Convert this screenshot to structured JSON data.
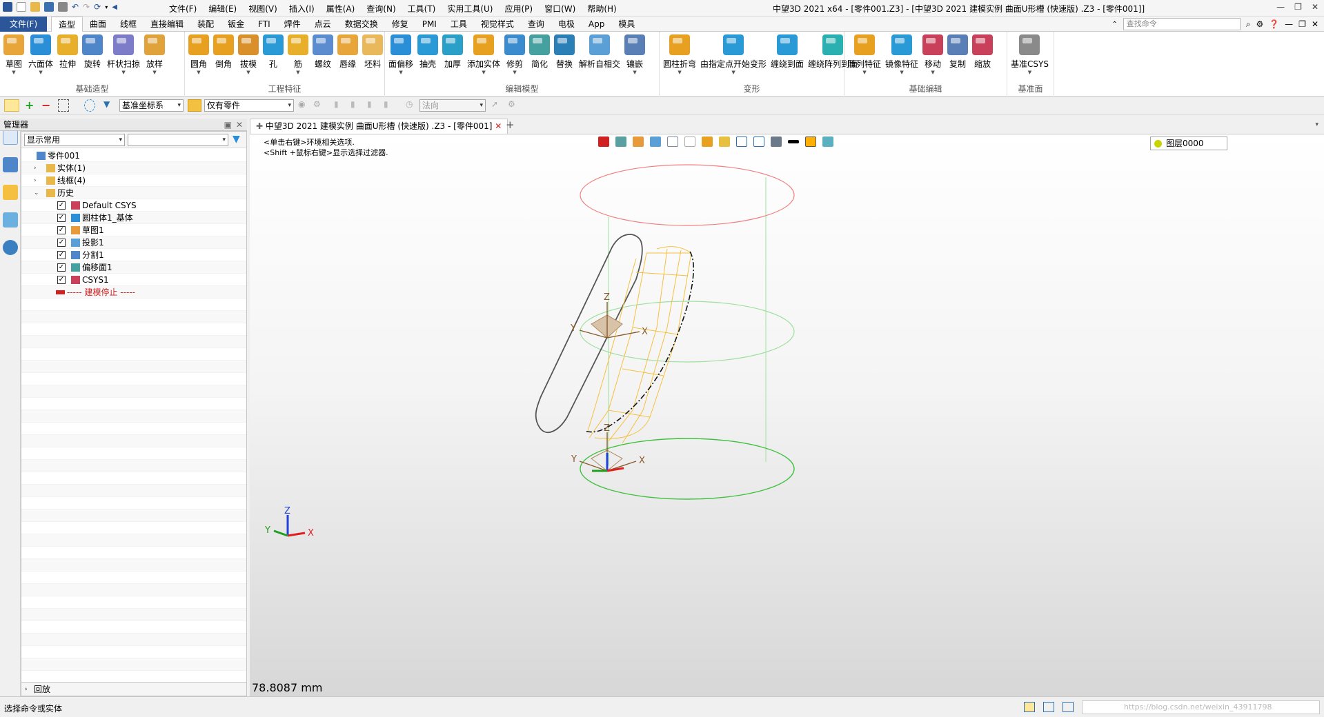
{
  "title_bar": {
    "window_title": "中望3D 2021 x64 - [零件001.Z3] - [中望3D 2021 建模实例 曲面U形槽 (快速版) .Z3 - [零件001]]",
    "menus": [
      "文件(F)",
      "编辑(E)",
      "视图(V)",
      "插入(I)",
      "属性(A)",
      "查询(N)",
      "工具(T)",
      "实用工具(U)",
      "应用(P)",
      "窗口(W)",
      "帮助(H)"
    ]
  },
  "ribbon_tabs": {
    "file_tab": "文件(F)",
    "tabs": [
      "造型",
      "曲面",
      "线框",
      "直接编辑",
      "装配",
      "钣金",
      "FTI",
      "焊件",
      "点云",
      "数据交换",
      "修复",
      "PMI",
      "工具",
      "视觉样式",
      "查询",
      "电极",
      "App",
      "模具"
    ],
    "active_index": 0,
    "command_search_placeholder": "查找命令"
  },
  "ribbon_groups": [
    {
      "label": "基础造型",
      "buttons": [
        {
          "label": "草图",
          "icon": "sketch-icon",
          "color": "#e8a63a",
          "dropdown": true
        },
        {
          "label": "六面体",
          "icon": "box-icon",
          "color": "#2a8fd6",
          "dropdown": true
        },
        {
          "label": "拉伸",
          "icon": "extrude-icon",
          "color": "#e8b02a",
          "dropdown": false
        },
        {
          "label": "旋转",
          "icon": "revolve-icon",
          "color": "#4f86c9",
          "dropdown": false
        },
        {
          "label": "杆状扫掠",
          "icon": "sweep-icon",
          "color": "#7c7cc9",
          "dropdown": true
        },
        {
          "label": "放样",
          "icon": "loft-icon",
          "color": "#e0a23a",
          "dropdown": true
        }
      ]
    },
    {
      "label": "工程特征",
      "buttons": [
        {
          "label": "圆角",
          "icon": "fillet-icon",
          "color": "#e8a020",
          "dropdown": true
        },
        {
          "label": "倒角",
          "icon": "chamfer-icon",
          "color": "#e8a020",
          "dropdown": false
        },
        {
          "label": "拔模",
          "icon": "draft-icon",
          "color": "#d9902a",
          "dropdown": true
        },
        {
          "label": "孔",
          "icon": "hole-icon",
          "color": "#2a9ad6",
          "dropdown": false
        },
        {
          "label": "筋",
          "icon": "rib-icon",
          "color": "#e8b02a",
          "dropdown": true
        },
        {
          "label": "螺纹",
          "icon": "thread-icon",
          "color": "#5a8ccf",
          "dropdown": false
        },
        {
          "label": "唇缘",
          "icon": "lip-icon",
          "color": "#e8a63a",
          "dropdown": false
        },
        {
          "label": "坯料",
          "icon": "stock-icon",
          "color": "#e8b85a",
          "dropdown": false
        }
      ]
    },
    {
      "label": "编辑模型",
      "buttons": [
        {
          "label": "面偏移",
          "icon": "face-offset-icon",
          "color": "#2a8fd6",
          "dropdown": true
        },
        {
          "label": "抽壳",
          "icon": "shell-icon",
          "color": "#2a9ad6",
          "dropdown": false
        },
        {
          "label": "加厚",
          "icon": "thicken-icon",
          "color": "#2aa0c9",
          "dropdown": false
        },
        {
          "label": "添加实体",
          "icon": "add-solid-icon",
          "color": "#e8a020",
          "dropdown": true
        },
        {
          "label": "修剪",
          "icon": "trim-icon",
          "color": "#3b8ccf",
          "dropdown": true
        },
        {
          "label": "简化",
          "icon": "simplify-icon",
          "color": "#45a0a0",
          "dropdown": false
        },
        {
          "label": "替换",
          "icon": "replace-icon",
          "color": "#2a7fb6",
          "dropdown": false
        },
        {
          "label": "解析自相交",
          "icon": "self-intersect-icon",
          "color": "#5a9fd6",
          "dropdown": false
        },
        {
          "label": "镶嵌",
          "icon": "emboss-icon",
          "color": "#5a7fb6",
          "dropdown": true
        }
      ]
    },
    {
      "label": "变形",
      "buttons": [
        {
          "label": "圆柱折弯",
          "icon": "cylinder-bend-icon",
          "color": "#e8a020",
          "dropdown": true
        },
        {
          "label": "由指定点开始变形",
          "icon": "point-deform-icon",
          "color": "#2a9ad6",
          "dropdown": true
        },
        {
          "label": "缠绕到面",
          "icon": "wrap-face-icon",
          "color": "#2a9ad6",
          "dropdown": false
        },
        {
          "label": "缠绕阵列到面",
          "icon": "wrap-pattern-icon",
          "color": "#2ab0b0",
          "dropdown": false
        }
      ]
    },
    {
      "label": "基础编辑",
      "buttons": [
        {
          "label": "阵列特征",
          "icon": "pattern-icon",
          "color": "#e8a020",
          "dropdown": true
        },
        {
          "label": "镜像特征",
          "icon": "mirror-icon",
          "color": "#2a9ad6",
          "dropdown": true
        },
        {
          "label": "移动",
          "icon": "move-icon",
          "color": "#c9405a",
          "dropdown": true
        },
        {
          "label": "复制",
          "icon": "copy-icon",
          "color": "#5a7fb6",
          "dropdown": false
        },
        {
          "label": "缩放",
          "icon": "scale-icon",
          "color": "#c9405a",
          "dropdown": false
        }
      ]
    },
    {
      "label": "基准面",
      "buttons": [
        {
          "label": "基准CSYS",
          "icon": "datum-csys-icon",
          "color": "#8a8a8a",
          "dropdown": true
        }
      ]
    }
  ],
  "toolbar2": {
    "coord_system": "基准坐标系",
    "filter": "仅有零件",
    "direction_placeholder": "法向"
  },
  "manager": {
    "title": "管理器",
    "filter_select": "显示常用",
    "tree": [
      {
        "label": "零件001",
        "level": 0,
        "twisty": "",
        "check": false,
        "icon": "part-icon"
      },
      {
        "label": "实体(1)",
        "level": 1,
        "twisty": "›",
        "check": false,
        "icon": "folder-icon"
      },
      {
        "label": "线框(4)",
        "level": 1,
        "twisty": "›",
        "check": false,
        "icon": "folder-icon"
      },
      {
        "label": "历史",
        "level": 1,
        "twisty": "⌄",
        "check": false,
        "icon": "folder-icon"
      },
      {
        "label": "Default CSYS",
        "level": 2,
        "twisty": "",
        "check": true,
        "icon": "csys-icon"
      },
      {
        "label": "圆柱体1_基体",
        "level": 2,
        "twisty": "",
        "check": true,
        "icon": "cylinder-icon"
      },
      {
        "label": "草图1",
        "level": 2,
        "twisty": "",
        "check": true,
        "icon": "sketch-icon"
      },
      {
        "label": "投影1",
        "level": 2,
        "twisty": "",
        "check": true,
        "icon": "project-icon"
      },
      {
        "label": "分割1",
        "level": 2,
        "twisty": "",
        "check": true,
        "icon": "split-icon"
      },
      {
        "label": "偏移面1",
        "level": 2,
        "twisty": "",
        "check": true,
        "icon": "offset-face-icon"
      },
      {
        "label": "CSYS1",
        "level": 2,
        "twisty": "",
        "check": true,
        "icon": "csys-icon"
      },
      {
        "label": "----- 建模停止 -----",
        "level": 2,
        "twisty": "",
        "check": false,
        "icon": "stop-arrow-icon",
        "color": "#d02020"
      }
    ],
    "replay_label": "回放"
  },
  "document_tab": {
    "label": "中望3D 2021 建模实例 曲面U形槽 (快速版) .Z3 - [零件001]"
  },
  "viewport": {
    "hint_line1": "<单击右键>环境相关选项.",
    "hint_line2": "<Shift +鼠标右键>显示选择过滤器.",
    "layer": "图层0000",
    "measurement": "78.8087 mm",
    "axis_labels": {
      "x": "X",
      "y": "Y",
      "z": "Z"
    }
  },
  "status_bar": {
    "text": "选择命令或实体",
    "watermark": "https://blog.csdn.net/weixin_43911798"
  },
  "colors": {
    "file_tab_bg": "#2b579a",
    "axis_x": "#e02020",
    "axis_y": "#20a020",
    "axis_z": "#2040e0",
    "circle_top": "#f08080",
    "circle_mid": "#9ee09e",
    "circle_bottom": "#40c040",
    "yellow_wire": "#f5c040"
  }
}
